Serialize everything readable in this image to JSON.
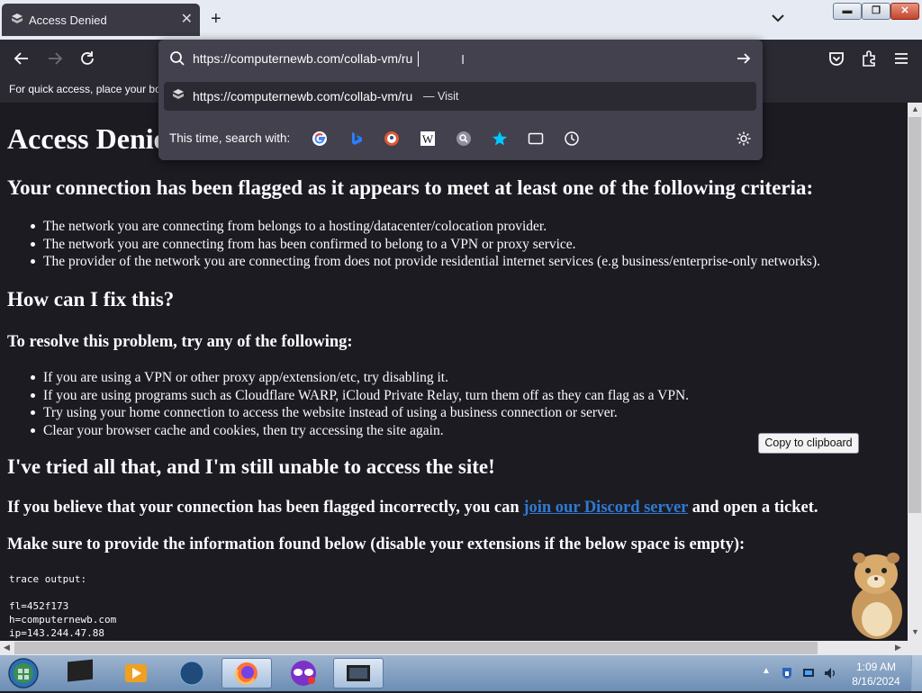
{
  "window": {
    "tab_title": "Access Denied",
    "new_tab_symbol": "+",
    "controls": [
      "minimize",
      "maximize",
      "close"
    ]
  },
  "toolbar": {
    "bookmarks_hint": "For quick access, place your bo",
    "icons": [
      "back-icon",
      "forward-icon",
      "reload-icon",
      "pocket-icon",
      "extensions-icon",
      "menu-icon"
    ]
  },
  "urlbar": {
    "value": "https://computernewb.com/collab-vm/ru",
    "suggestion_url": "https://computernewb.com/collab-vm/ru",
    "suggestion_action": "— Visit",
    "search_with_label": "This time, search with:",
    "engines": [
      "google",
      "bing",
      "duckduckgo",
      "wikipedia",
      "search-engine",
      "bookmarks",
      "tabs",
      "history"
    ]
  },
  "page": {
    "h1": "Access Denied",
    "h2a": "Your connection has been flagged as it appears to meet at least one of the following criteria:",
    "criteria": [
      "The network you are connecting from belongs to a hosting/datacenter/colocation provider.",
      "The network you are connecting from has been confirmed to belong to a VPN or proxy service.",
      "The provider of the network you are connecting from does not provide residential internet services (e.g business/enterprise-only networks)."
    ],
    "h2b": "How can I fix this?",
    "h3a": "To resolve this problem, try any of the following:",
    "fixes": [
      "If you are using a VPN or other proxy app/extension/etc, try disabling it.",
      "If you are using programs such as Cloudflare WARP, iCloud Private Relay, turn them off as they can flag as a VPN.",
      "Try using your home connection to access the website instead of using a business connection or server.",
      "Clear your browser cache and cookies, then try accessing the site again."
    ],
    "h2c": "I've tried all that, and I'm still unable to access the site!",
    "discord_before": "If you believe that your connection has been flagged incorrectly, you can ",
    "discord_link": "join our Discord server",
    "discord_after": " and open a ticket.",
    "make_sure": "Make sure to provide the information found below (disable your extensions if the below space is empty):",
    "copy_button": "Copy to clipboard",
    "trace_label": "trace output:",
    "trace_lines": [
      "fl=452f173",
      "h=computernewb.com",
      "ip=143.244.47.88"
    ]
  },
  "taskbar": {
    "time": "1:09 AM",
    "date": "8/16/2024"
  },
  "colors": {
    "page_bg": "#1c1b22",
    "link": "#2f7ad0",
    "panel": "#42414d"
  }
}
